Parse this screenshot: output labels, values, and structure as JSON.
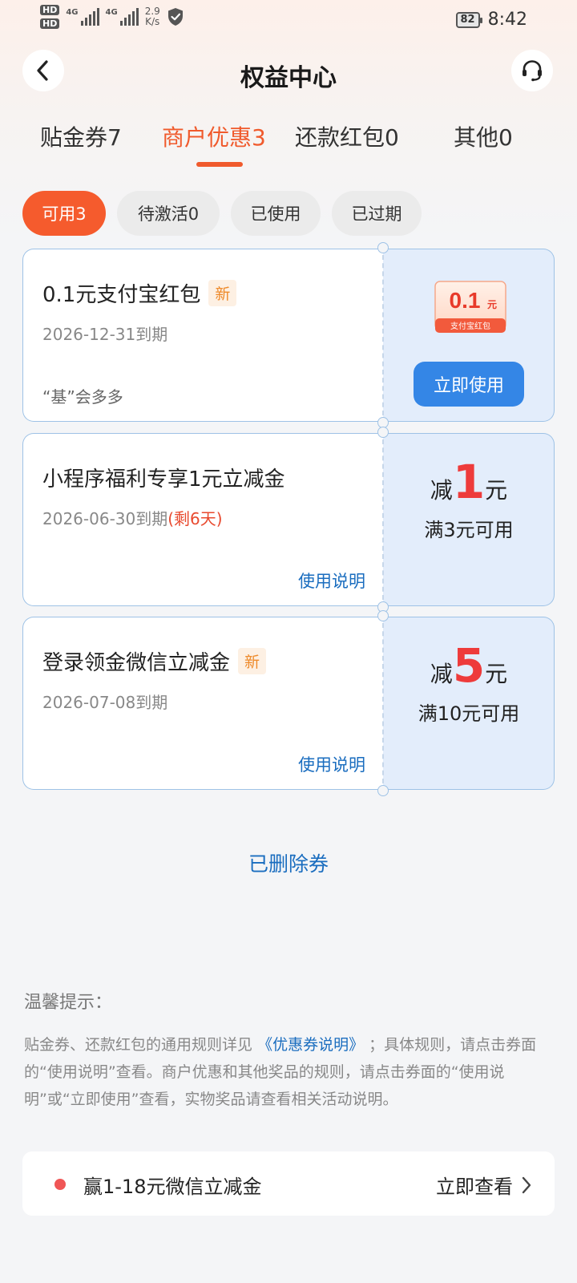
{
  "status_bar": {
    "hd1": "HD",
    "hd2": "HD",
    "net1": "4G",
    "net2": "4G",
    "speed_value": "2.9",
    "speed_unit": "K/s",
    "battery": "82",
    "time": "8:42"
  },
  "header": {
    "title": "权益中心",
    "back_icon": "chevron-left-icon",
    "service_icon": "headset-icon"
  },
  "tabs": [
    {
      "label": "贴金券7",
      "active": false
    },
    {
      "label": "商户优惠3",
      "active": true
    },
    {
      "label": "还款红包0",
      "active": false
    },
    {
      "label": "其他0",
      "active": false
    }
  ],
  "filters": [
    {
      "label": "可用3",
      "active": true
    },
    {
      "label": "待激活0",
      "active": false
    },
    {
      "label": "已使用",
      "active": false
    },
    {
      "label": "已过期",
      "active": false
    }
  ],
  "coupons": [
    {
      "title": "0.1元支付宝红包",
      "badge": "新",
      "expiry": "2026-12-31到期",
      "merchant": "“基”会多多",
      "image_amount": "0.1",
      "image_unit": "元",
      "image_caption": "支付宝红包",
      "button": "立即使用"
    },
    {
      "title": "小程序福利专享1元立减金",
      "expiry": "2026-06-30到期",
      "remaining": "(剩6天)",
      "link": "使用说明",
      "prefix": "减",
      "amount": "1",
      "unit": "元",
      "threshold": "满3元可用"
    },
    {
      "title": "登录领金微信立减金",
      "badge": "新",
      "expiry": "2026-07-08到期",
      "link": "使用说明",
      "prefix": "减",
      "amount": "5",
      "unit": "元",
      "threshold": "满10元可用"
    }
  ],
  "deleted_link": "已删除券",
  "tips": {
    "title": "温馨提示：",
    "text_before": "贴金券、还款红包的通用规则详见",
    "link": "《优惠券说明》",
    "text_after": "；具体规则，请点击券面的“使用说明”查看。商户优惠和其他奖品的规则，请点击券面的“使用说明”或“立即使用”查看，实物奖品请查看相关活动说明。"
  },
  "promo": {
    "text": "赢1-18元微信立减金",
    "action": "立即查看"
  },
  "colors": {
    "accent": "#f05a2c",
    "link": "#1a6dbf",
    "button": "#3486e6",
    "amount": "#ee3b3b"
  }
}
